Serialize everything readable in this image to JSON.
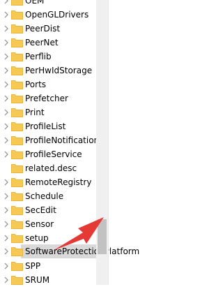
{
  "registry_tree": {
    "items": [
      {
        "label": "OEM"
      },
      {
        "label": "OpenGLDrivers"
      },
      {
        "label": "PeerDist"
      },
      {
        "label": "PeerNet"
      },
      {
        "label": "Perflib"
      },
      {
        "label": "PerHwIdStorage"
      },
      {
        "label": "Ports"
      },
      {
        "label": "Prefetcher"
      },
      {
        "label": "Print"
      },
      {
        "label": "ProfileList"
      },
      {
        "label": "ProfileNotification"
      },
      {
        "label": "ProfileService"
      },
      {
        "label": "related.desc"
      },
      {
        "label": "RemoteRegistry"
      },
      {
        "label": "Schedule"
      },
      {
        "label": "SecEdit"
      },
      {
        "label": "Sensor"
      },
      {
        "label": "setup"
      },
      {
        "label": "SoftwareProtectionPlatform"
      },
      {
        "label": "SPP"
      },
      {
        "label": "SRUM"
      }
    ],
    "selected_label": "SoftwareProtectionPlatform"
  },
  "colors": {
    "folder": "#f6c955",
    "folder_tab": "#e8b542",
    "chevron": "#8a8a8a",
    "selection": "#d9d9d9",
    "annotation_arrow": "#e53935"
  },
  "icons": {
    "expand": "chevron-right-icon",
    "folder": "folder-icon",
    "annotation": "red-pointer-arrow"
  }
}
